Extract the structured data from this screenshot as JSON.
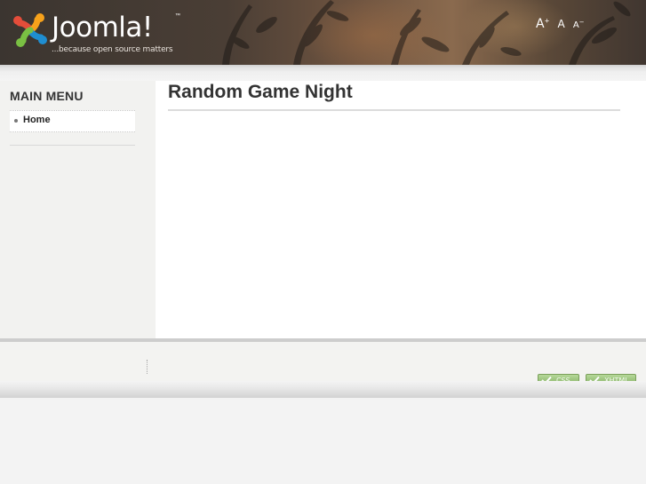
{
  "header": {
    "logo": {
      "name": "Joomla!",
      "wordmark": "Joomla!",
      "tm": "™",
      "tagline": "...because open source matters"
    },
    "font_sizer": {
      "bigger": "A",
      "bigger_sup": "+",
      "reset": "A",
      "smaller": "A",
      "smaller_sup": "−"
    }
  },
  "sidebar": {
    "heading": "MAIN MENU",
    "items": [
      {
        "label": "Home",
        "active": true
      }
    ]
  },
  "main": {
    "title": "Random Game Night"
  },
  "footer": {
    "badges": [
      {
        "label": "CSS",
        "icon": "check-icon"
      },
      {
        "label": "XHTML",
        "icon": "check-icon"
      }
    ]
  },
  "colors": {
    "header_bg": "#4a3e35",
    "sidebar_bg": "#f2f2f0",
    "content_bg": "#ffffff",
    "page_bg": "#f3f3f3",
    "badge_green": "#86b266",
    "joomla_red": "#e44d3a",
    "joomla_orange": "#f7a21b",
    "joomla_blue": "#1f8ed1",
    "joomla_green": "#7ac043"
  }
}
